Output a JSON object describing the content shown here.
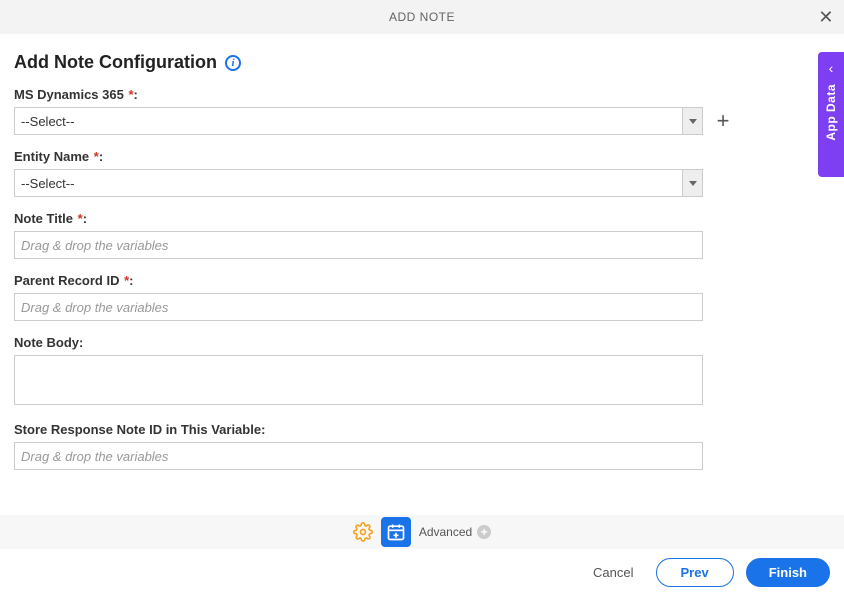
{
  "header": {
    "title": "ADD NOTE"
  },
  "page": {
    "title": "Add Note Configuration"
  },
  "fields": {
    "msdynamics": {
      "label": "MS Dynamics 365",
      "required": true,
      "value": "--Select--"
    },
    "entity": {
      "label": "Entity Name",
      "required": true,
      "value": "--Select--"
    },
    "noteTitle": {
      "label": "Note Title",
      "required": true,
      "placeholder": "Drag & drop the variables"
    },
    "parentRecord": {
      "label": "Parent Record ID",
      "required": true,
      "placeholder": "Drag & drop the variables"
    },
    "noteBody": {
      "label": "Note Body",
      "required": false
    },
    "storeResponse": {
      "label": "Store Response Note ID in This Variable",
      "required": false,
      "placeholder": "Drag & drop the variables"
    }
  },
  "toolbar": {
    "advanced": "Advanced"
  },
  "buttons": {
    "cancel": "Cancel",
    "prev": "Prev",
    "finish": "Finish"
  },
  "sideTab": {
    "label": "App Data"
  }
}
